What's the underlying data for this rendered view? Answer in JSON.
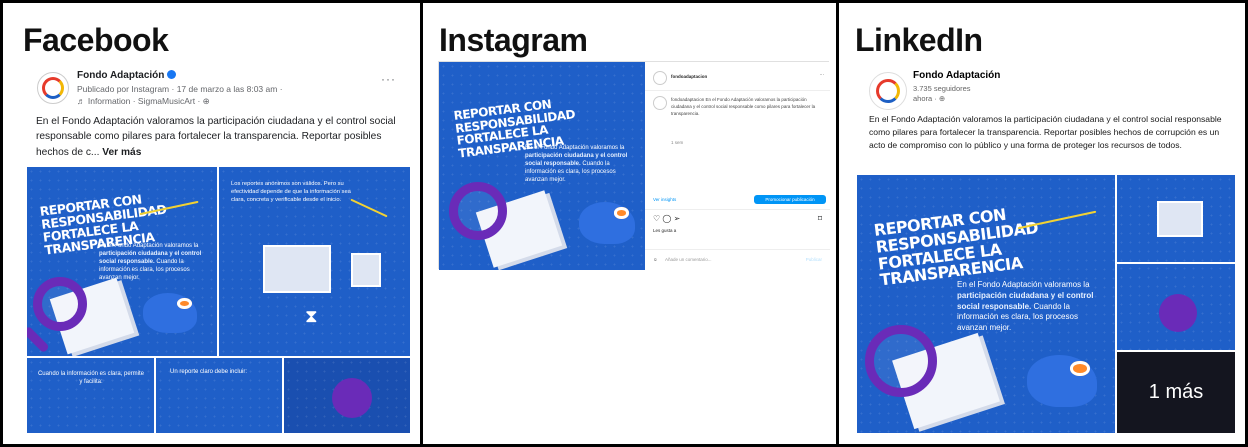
{
  "panels": {
    "facebook": "Facebook",
    "instagram": "Instagram",
    "linkedin": "LinkedIn"
  },
  "facebook_post": {
    "page_name": "Fondo Adaptación",
    "meta_line": "Publicado por Instagram · 17 de marzo a las 8:03 am ·",
    "music_line": "♬ Information · SigmaMusicArt · ",
    "text": "En el Fondo Adaptación valoramos la participación ciudadana y el control social responsable como pilares para fortalecer la transparencia. Reportar posibles hechos de c...",
    "see_more": "Ver más",
    "more_icon": "···"
  },
  "artwork": {
    "headline": "Reportar con responsabilidad fortalece la transparencia",
    "body_1": "En el Fondo Adaptación valoramos la",
    "body_bold": "participación ciudadana y el control social responsable.",
    "body_2": "Cuando la información es clara, los procesos avanzan mejor.",
    "fb_tile_text": "Los reportes anónimos son válidos. Pero su efectividad depende de que la información sea clara, concreta y verificable desde el inicio.",
    "fb_bottom_1": "Cuando la información es clara, permite y facilita:",
    "fb_bottom_2": "Un reporte claro debe incluir:"
  },
  "instagram_post": {
    "account": "fondoadaptacion",
    "caption": "fondoadaptacion En el Fondo Adaptación valoramos la participación ciudadana y el control social responsable como pilares para fortalecer la transparencia.",
    "time": "1 sem",
    "insights": "Ver insights",
    "promote_button": "Promocionar publicación",
    "likes": "Les gusta a",
    "comment_placeholder": "Añade un comentario...",
    "post_action": "Publicar"
  },
  "linkedin_post": {
    "page_name": "Fondo Adaptación",
    "followers": "3.735 seguidores",
    "time": "ahora · ",
    "text": "En el Fondo Adaptación valoramos la participación ciudadana y el control social responsable como pilares para fortalecer la transparencia. Reportar posibles hechos de corrupción es un acto de compromiso con lo público y una forma de proteger los recursos de todos.",
    "more_overlay": "1 más"
  },
  "colors": {
    "art_blue": "#1f5fc8",
    "accent_purple": "#6a2bb8",
    "accent_yellow": "#f2d233",
    "fb_blue": "#1877f2",
    "ig_blue": "#0095f6"
  }
}
